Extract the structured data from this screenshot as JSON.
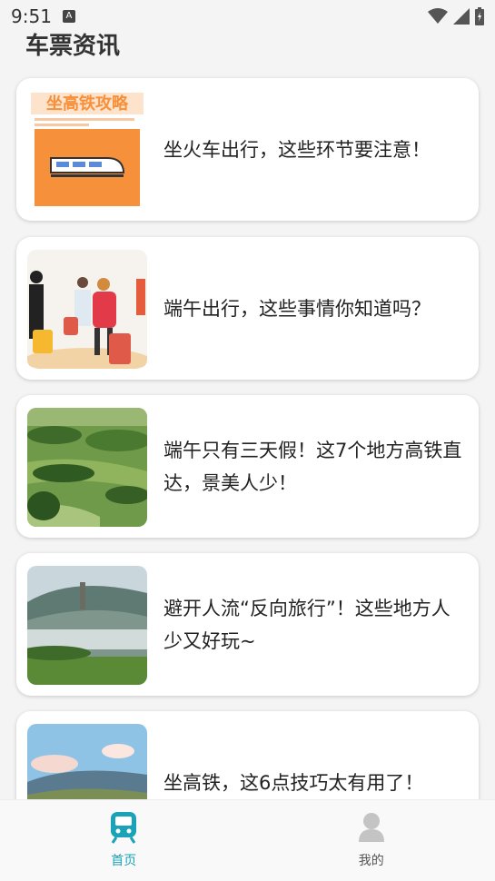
{
  "status_bar": {
    "time": "9:51",
    "notification_icon": "A"
  },
  "page_title": "车票资讯",
  "articles": [
    {
      "title": "坐火车出行，这些环节要注意！",
      "thumb_caption": "坐高铁攻略"
    },
    {
      "title": "端午出行，这些事情你知道吗？"
    },
    {
      "title": "端午只有三天假！这7个地方高铁直达，景美人少！"
    },
    {
      "title": "避开人流“反向旅行”！这些地方人少又好玩~"
    },
    {
      "title": "坐高铁，这6点技巧太有用了！"
    }
  ],
  "tabs": [
    {
      "label": "首页",
      "icon": "train-icon",
      "active": true
    },
    {
      "label": "我的",
      "icon": "user-icon",
      "active": false
    }
  ],
  "colors": {
    "accent": "#1aa3b8",
    "card_bg": "#ffffff",
    "page_bg": "#f4f4f4",
    "orange": "#f7903a"
  }
}
